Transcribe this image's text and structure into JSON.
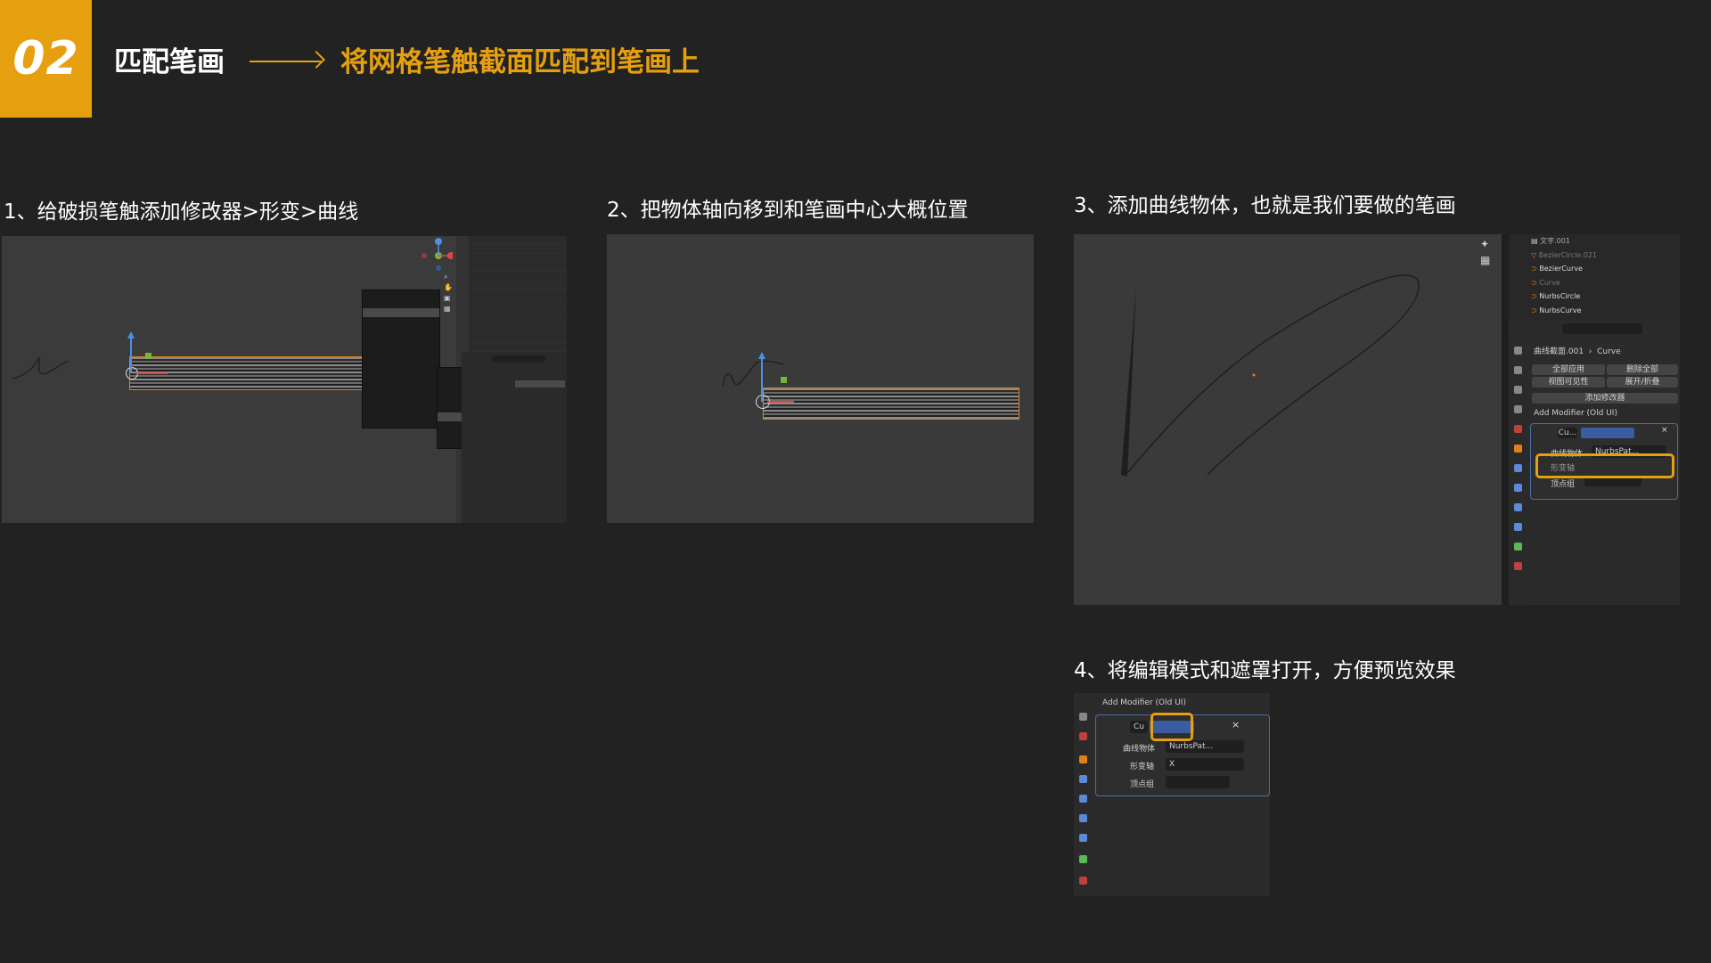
{
  "header": {
    "badge": "02",
    "title": "匹配笔画",
    "subtitle": "将网格笔触截面匹配到笔画上"
  },
  "colors": {
    "accent": "#E6A00F",
    "background": "#222223"
  },
  "steps": [
    {
      "label": "1、给破损笔触添加修改器>形变>曲线"
    },
    {
      "label": "2、把物体轴向移到和笔画中心大概位置"
    },
    {
      "label": "3、添加曲线物体，也就是我们要做的笔画"
    },
    {
      "label": "4、将编辑模式和遮罩打开，方便预览效果"
    }
  ],
  "shot3": {
    "outliner": [
      {
        "name": "文字.001",
        "icon": "text-icon"
      },
      {
        "name": "BezierCircle.021",
        "icon": "mesh-icon"
      },
      {
        "name": "BezierCurve",
        "icon": "curve-icon"
      },
      {
        "name": "Curve",
        "icon": "curve-icon"
      },
      {
        "name": "NurbsCircle",
        "icon": "curve-icon"
      },
      {
        "name": "NurbsCurve",
        "icon": "curve-icon"
      }
    ],
    "breadcrumb_obj": "曲线截面.001",
    "breadcrumb_data": "Curve",
    "apply_all": "全部应用",
    "delete_all": "删除全部",
    "viewport_visible": "视图可见性",
    "expand_collapse": "展开/折叠",
    "add_modifier_btn": "添加修改器",
    "add_modifier_old": "Add Modifier (Old UI)",
    "mod_name": "Cu...",
    "curve_object_label": "曲线物体",
    "curve_object_value": "NurbsPat...",
    "deform_axis_label": "形变轴",
    "vertex_group_label": "顶点组"
  },
  "shot4": {
    "add_modifier_old": "Add Modifier (Old UI)",
    "mod_name": "Cu",
    "curve_object_label": "曲线物体",
    "curve_object_value": "NurbsPat...",
    "deform_axis_label": "形变轴",
    "deform_axis_value": "X",
    "vertex_group_label": "顶点组"
  }
}
